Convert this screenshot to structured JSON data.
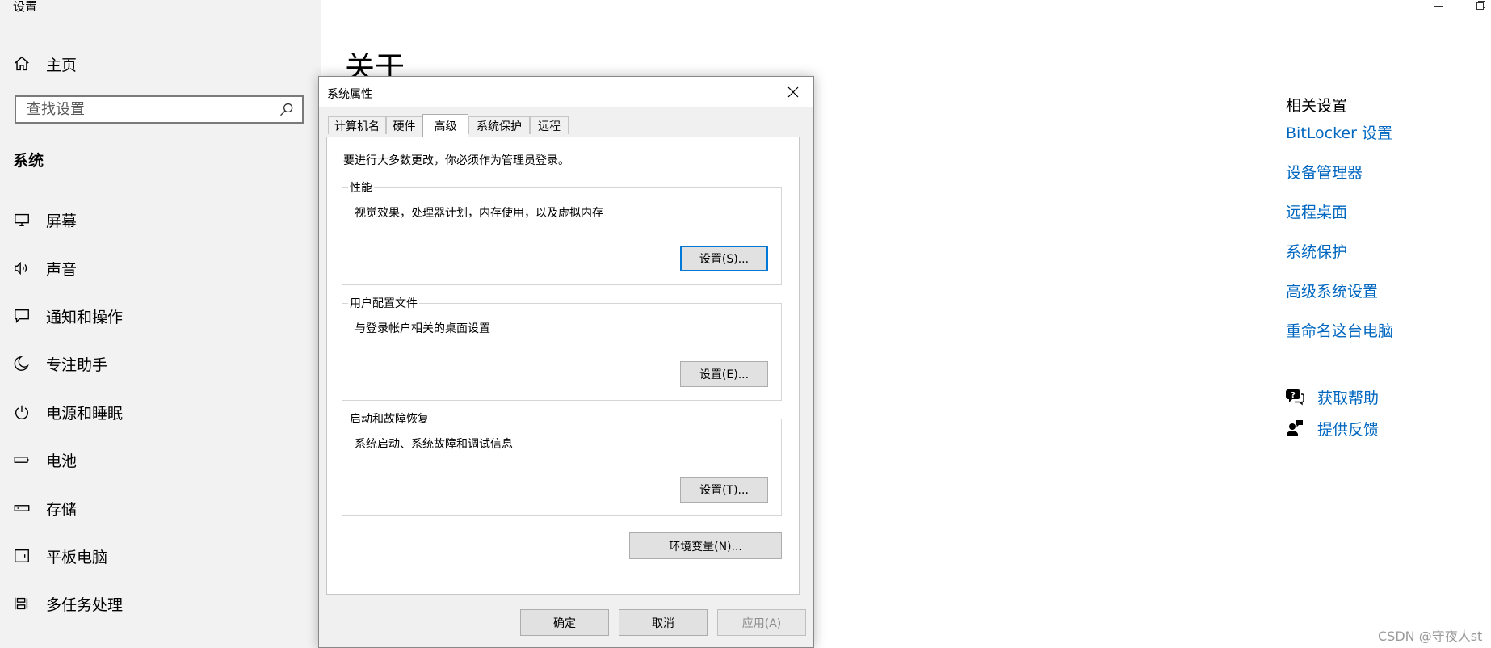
{
  "app": {
    "title": "设置"
  },
  "sidebar": {
    "home_label": "主页",
    "search_placeholder": "查找设置",
    "section_header": "系统",
    "items": [
      {
        "label": "屏幕",
        "icon": "monitor-icon"
      },
      {
        "label": "声音",
        "icon": "speaker-icon"
      },
      {
        "label": "通知和操作",
        "icon": "notification-icon"
      },
      {
        "label": "专注助手",
        "icon": "moon-icon"
      },
      {
        "label": "电源和睡眠",
        "icon": "power-icon"
      },
      {
        "label": "电池",
        "icon": "battery-icon"
      },
      {
        "label": "存储",
        "icon": "storage-icon"
      },
      {
        "label": "平板电脑",
        "icon": "tablet-icon"
      },
      {
        "label": "多任务处理",
        "icon": "multitasking-icon"
      }
    ]
  },
  "main": {
    "page_title": "关于"
  },
  "related": {
    "title": "相关设置",
    "links": [
      "BitLocker 设置",
      "设备管理器",
      "远程桌面",
      "系统保护",
      "高级系统设置",
      "重命名这台电脑"
    ],
    "help": [
      {
        "label": "获取帮助",
        "icon": "help-chat-icon"
      },
      {
        "label": "提供反馈",
        "icon": "feedback-icon"
      }
    ]
  },
  "dialog": {
    "title": "系统属性",
    "tabs": [
      "计算机名",
      "硬件",
      "高级",
      "系统保护",
      "远程"
    ],
    "active_tab": "高级",
    "admin_note": "要进行大多数更改，你必须作为管理员登录。",
    "groups": [
      {
        "title": "性能",
        "description": "视觉效果，处理器计划，内存使用，以及虚拟内存",
        "button": "设置(S)..."
      },
      {
        "title": "用户配置文件",
        "description": "与登录帐户相关的桌面设置",
        "button": "设置(E)..."
      },
      {
        "title": "启动和故障恢复",
        "description": "系统启动、系统故障和调试信息",
        "button": "设置(T)..."
      }
    ],
    "env_button": "环境变量(N)...",
    "ok_button": "确定",
    "cancel_button": "取消",
    "apply_button": "应用(A)"
  },
  "watermark": "CSDN @守夜人st",
  "colors": {
    "link": "#0067c0",
    "sidebar_bg": "#f2f2f2",
    "focus_border": "#0078d7"
  }
}
